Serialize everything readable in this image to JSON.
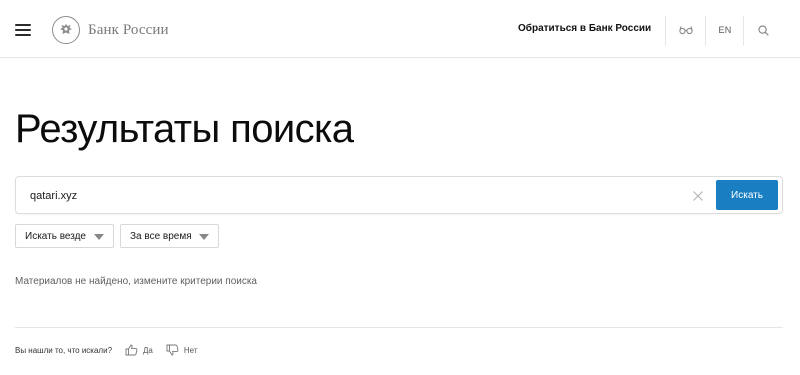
{
  "header": {
    "logo_text": "Банк России",
    "contact_link": "Обратиться в Банк России",
    "lang": "EN",
    "icons": {
      "menu": "hamburger-menu-icon",
      "emblem": "eagle-emblem-icon",
      "accessibility": "glasses-icon",
      "search": "search-icon"
    }
  },
  "main": {
    "title": "Результаты поиска",
    "search": {
      "value": "qatari.xyz",
      "placeholder": "",
      "button_label": "Искать"
    },
    "filters": [
      {
        "label": "Искать везде"
      },
      {
        "label": "За все время"
      }
    ],
    "no_results": "Материалов не найдено, измените критерии поиска"
  },
  "feedback": {
    "question": "Вы нашли то, что искали?",
    "yes": "Да",
    "no": "Нет"
  },
  "colors": {
    "accent": "#1a7ec2",
    "text": "#0f0f0f",
    "muted": "#5f5f5f",
    "border": "#e6e6e6"
  }
}
